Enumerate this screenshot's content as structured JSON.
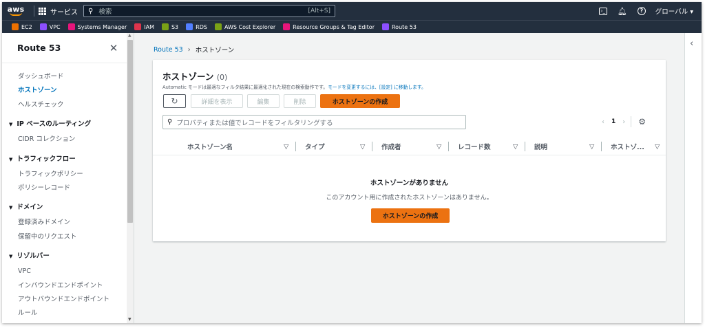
{
  "topbar": {
    "logo": "aws",
    "services_label": "サービス",
    "search_placeholder": "検索",
    "search_shortcut": "[Alt+S]",
    "region": "グローバル ▾"
  },
  "favorites": [
    {
      "label": "EC2",
      "color": "#ed7100"
    },
    {
      "label": "VPC",
      "color": "#8c4fff"
    },
    {
      "label": "Systems Manager",
      "color": "#e7157b"
    },
    {
      "label": "IAM",
      "color": "#dd344c"
    },
    {
      "label": "S3",
      "color": "#7aa116"
    },
    {
      "label": "RDS",
      "color": "#527fff"
    },
    {
      "label": "AWS Cost Explorer",
      "color": "#7aa116"
    },
    {
      "label": "Resource Groups & Tag Editor",
      "color": "#e7157b"
    },
    {
      "label": "Route 53",
      "color": "#8c4fff"
    }
  ],
  "sidebar": {
    "title": "Route 53",
    "items": [
      "ダッシュボード",
      "ホストゾーン",
      "ヘルスチェック"
    ],
    "sections": [
      {
        "title": "IP ベースのルーティング",
        "items": [
          "CIDR コレクション"
        ]
      },
      {
        "title": "トラフィックフロー",
        "items": [
          "トラフィックポリシー",
          "ポリシーレコード"
        ]
      },
      {
        "title": "ドメイン",
        "items": [
          "登録済みドメイン",
          "保留中のリクエスト"
        ]
      },
      {
        "title": "リゾルバー",
        "items": [
          "VPC",
          "インバウンドエンドポイント",
          "アウトバウンドエンドポイント",
          "ルール"
        ]
      }
    ]
  },
  "breadcrumb": {
    "root": "Route 53",
    "separator": "›",
    "current": "ホストゾーン"
  },
  "panel": {
    "title": "ホストゾーン",
    "count": "(0)",
    "desc_prefix": "Automatic モードは最適なフィルタ結果に最適化された現在の検索動作です。",
    "desc_link1": "モードを変更するには、[設定]",
    "desc_suffix": " に移動します。",
    "buttons": {
      "refresh": "↻",
      "details": "詳細を表示",
      "edit": "編集",
      "delete": "削除",
      "create": "ホストゾーンの作成"
    },
    "filter_placeholder": "プロパティまたは値でレコードをフィルタリングする",
    "page": "1",
    "columns": [
      "ホストゾーン名",
      "タイプ",
      "作成者",
      "レコード数",
      "説明",
      "ホストゾ..."
    ],
    "empty_title": "ホストゾーンがありません",
    "empty_desc": "このアカウント用に作成されたホストゾーンはありません。",
    "empty_button": "ホストゾーンの作成"
  }
}
